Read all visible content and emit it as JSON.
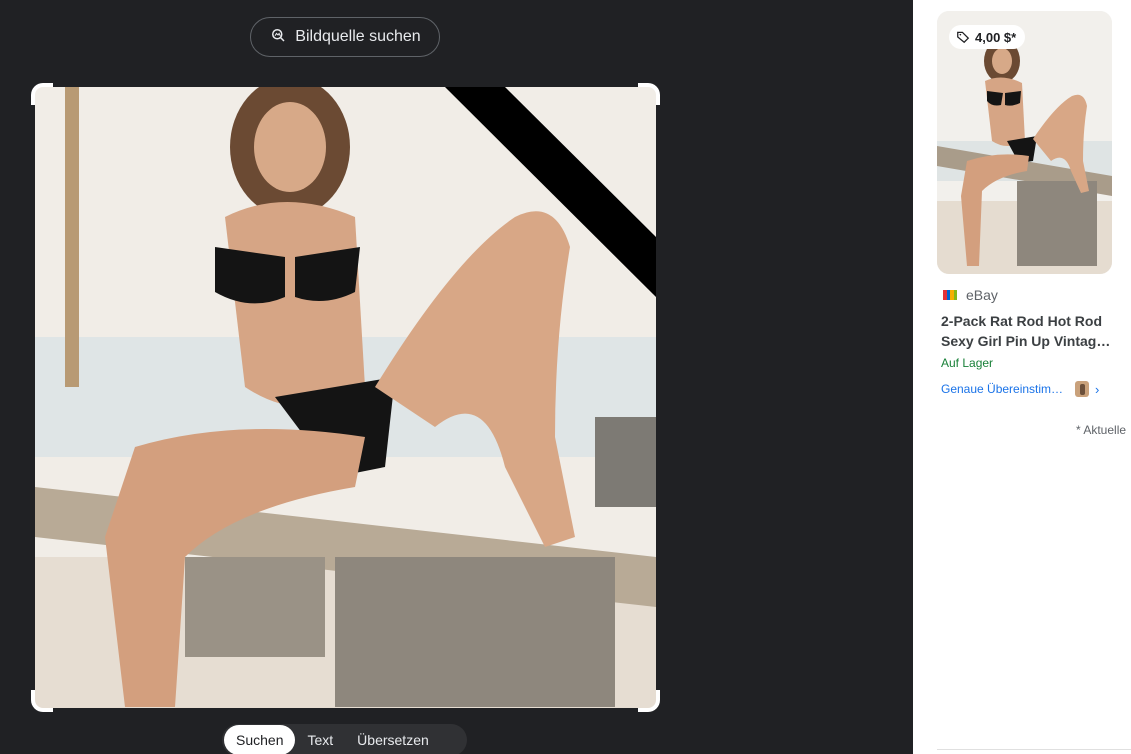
{
  "toolbar": {
    "source_button_label": "Bildquelle suchen",
    "source_button_icon": "image-search-icon"
  },
  "mode_tabs": [
    {
      "label": "Suchen",
      "active": true
    },
    {
      "label": "Text",
      "active": false
    },
    {
      "label": "Übersetzen",
      "active": false
    }
  ],
  "result": {
    "price": "4,00 $*",
    "price_icon": "price-tag-icon",
    "source": "eBay",
    "source_icon": "ebay-favicon-icon",
    "title": "2-Pack Rat Rod Hot Rod Sexy Girl Pin Up Vintag…",
    "stock": "Auf Lager",
    "match_label": "Genaue Übereinstim…",
    "chevron": "›"
  },
  "footnote": "* Aktuelle",
  "colors": {
    "background_dark": "#202124",
    "panel_white": "#ffffff",
    "link_blue": "#1a73e8",
    "stock_green": "#188038"
  }
}
